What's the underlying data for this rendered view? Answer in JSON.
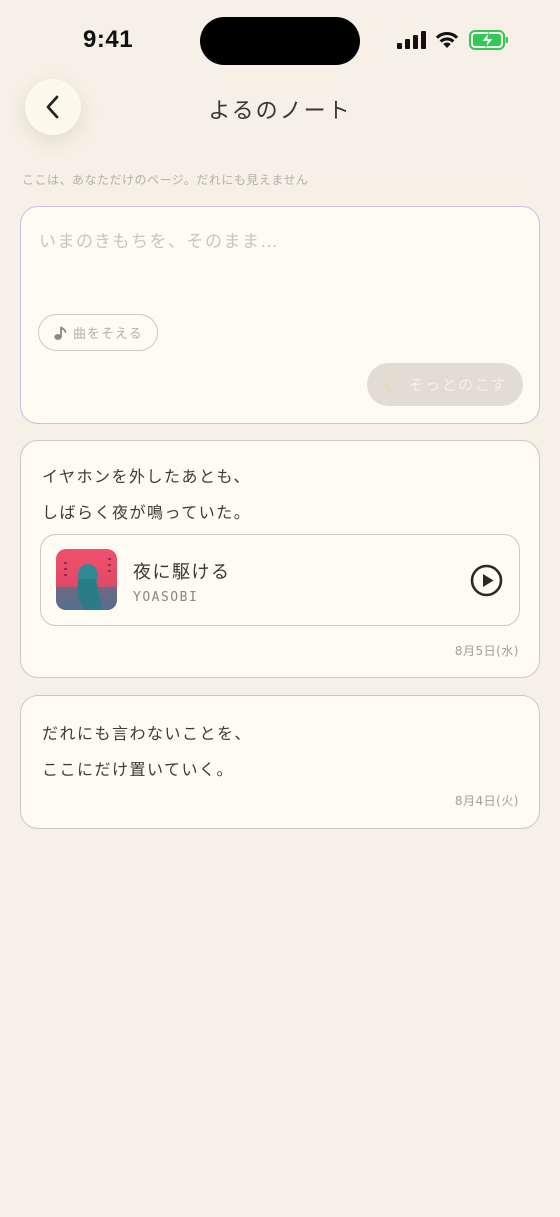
{
  "status": {
    "time": "9:41"
  },
  "header": {
    "title": "よるのノート"
  },
  "subtitle": "ここは、あなただけのページ。だれにも見えません",
  "composer": {
    "placeholder": "いまのきもちを、そのまま…",
    "add_song_label": "曲をそえる",
    "save_label": "そっとのこす"
  },
  "entries": [
    {
      "lines": [
        "イヤホンを外したあとも、",
        "しばらく夜が鳴っていた。"
      ],
      "song": {
        "title": "夜に駆ける",
        "artist": "YOASOBI"
      },
      "date": "8月5日(水)"
    },
    {
      "lines": [
        "だれにも言わないことを、",
        "ここにだけ置いていく。"
      ],
      "date": "8月4日(火)"
    }
  ],
  "colors": {
    "background": "#f7f0e6",
    "card": "#fefcf2",
    "composer_border": "#c9c0e6",
    "album_pink": "#e9506a",
    "battery_green": "#34c759"
  },
  "icons": [
    "back-chevron-icon",
    "music-note-icon",
    "moon-icon",
    "play-icon"
  ]
}
